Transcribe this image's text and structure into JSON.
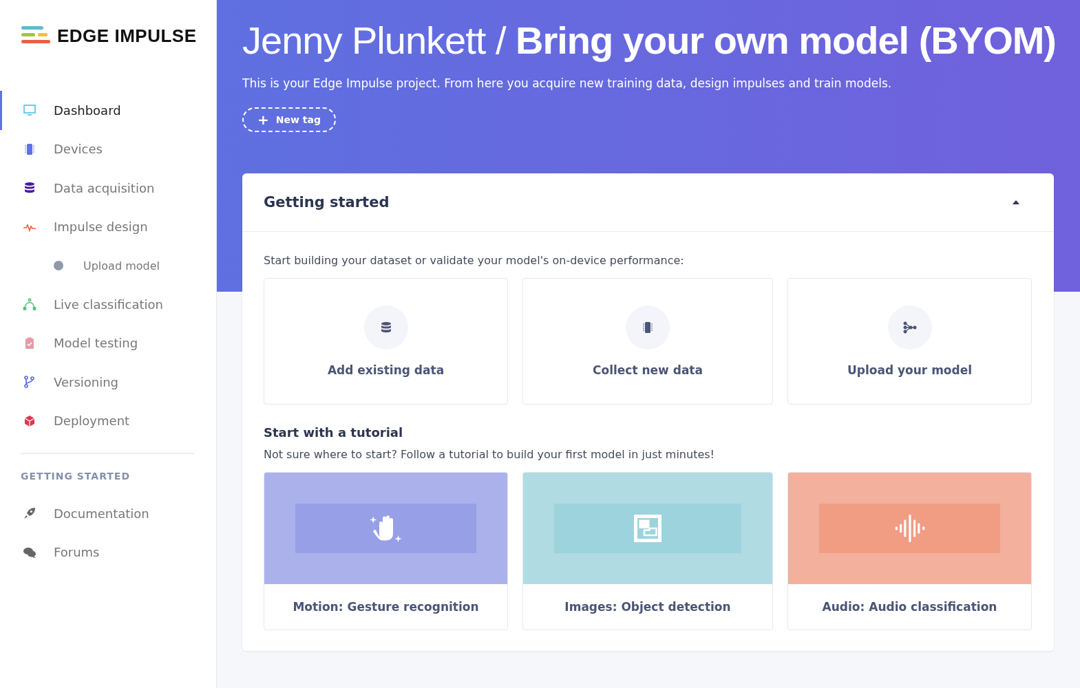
{
  "logo": {
    "text": "EDGE IMPULSE"
  },
  "sidebar": {
    "items": [
      {
        "label": "Dashboard",
        "kind": "monitor",
        "selected": true
      },
      {
        "label": "Devices",
        "kind": "chip",
        "selected": false
      },
      {
        "label": "Data acquisition",
        "kind": "database",
        "selected": false
      },
      {
        "label": "Impulse design",
        "kind": "pulse",
        "selected": false,
        "children": [
          {
            "label": "Upload model",
            "selected": false
          }
        ]
      },
      {
        "label": "Live classification",
        "kind": "curve",
        "selected": false
      },
      {
        "label": "Model testing",
        "kind": "clipboard",
        "selected": false
      },
      {
        "label": "Versioning",
        "kind": "branch",
        "selected": false
      },
      {
        "label": "Deployment",
        "kind": "cube",
        "selected": false
      }
    ],
    "section_heading": "GETTING STARTED",
    "links": [
      {
        "label": "Documentation",
        "kind": "rocket"
      },
      {
        "label": "Forums",
        "kind": "chat"
      }
    ]
  },
  "header": {
    "title": "Jenny Plunkett / **Bring your own model (BYOM)**",
    "description": "This is your Edge Impulse project. From here you acquire new training data, design impulses and train models.",
    "tag_button": {
      "icon": "+",
      "label": "New tag"
    }
  },
  "getting_started": {
    "title": "Getting started",
    "expanded": true,
    "intro": "Start building your dataset or validate your model's on-device performance:",
    "actions": [
      {
        "label": "Add existing data",
        "kind": "database"
      },
      {
        "label": "Collect new data",
        "kind": "chip"
      },
      {
        "label": "Upload your model",
        "kind": "network"
      }
    ],
    "tutorial_heading": "Start with a tutorial",
    "tutorial_intro": "Not sure where to start? Follow a tutorial to build your first model in just minutes!",
    "tutorials": [
      {
        "label": "Motion: Gesture recognition",
        "kind": "hand",
        "color": "#979fe6"
      },
      {
        "label": "Images: Object detection",
        "kind": "frame",
        "color": "#9dd3dc"
      },
      {
        "label": "Audio: Audio classification",
        "kind": "wave",
        "color": "#f09d84"
      }
    ]
  }
}
